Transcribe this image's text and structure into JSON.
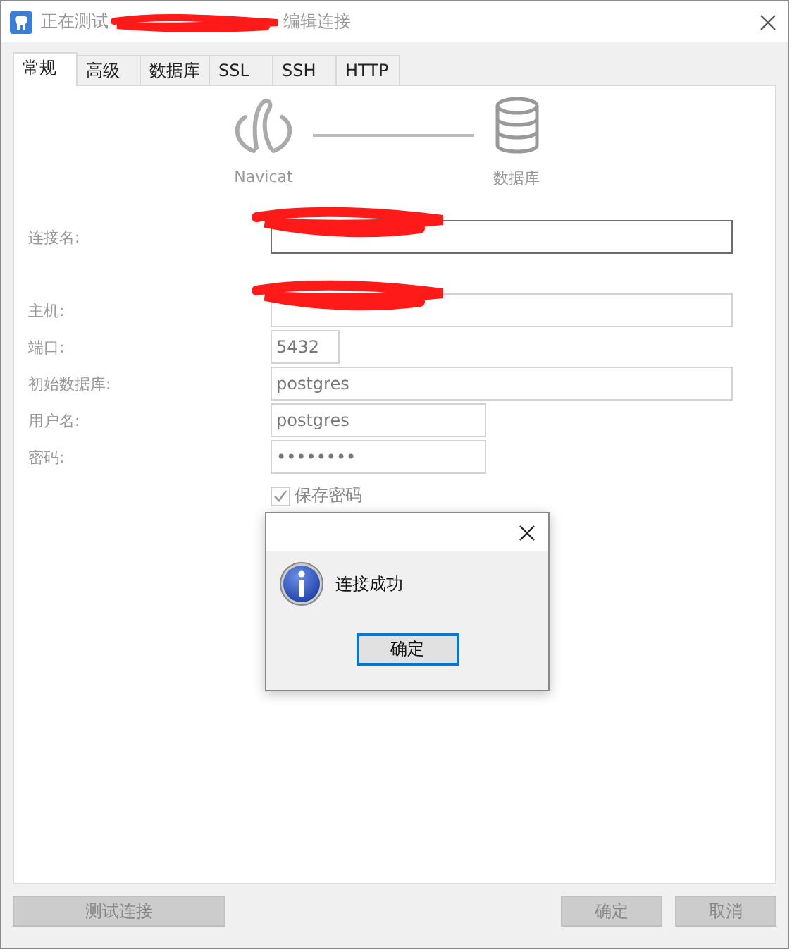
{
  "window": {
    "title_start": "正在测试",
    "title_end": "编辑连接",
    "title_redacted": true,
    "disabled": true
  },
  "tabs": [
    {
      "label": "常规",
      "selected": true
    },
    {
      "label": "高级",
      "selected": false
    },
    {
      "label": "数据库",
      "selected": false
    },
    {
      "label": "SSL",
      "selected": false
    },
    {
      "label": "SSH",
      "selected": false
    },
    {
      "label": "HTTP",
      "selected": false
    }
  ],
  "diagram": {
    "left_label": "Navicat",
    "right_label": "数据库"
  },
  "fields": [
    {
      "label": "连接名:",
      "focused": true,
      "redacted": true
    },
    {
      "label": "主机:",
      "focused": false,
      "redacted": true
    },
    {
      "label": "端口:",
      "value": "5432",
      "focused": false,
      "redacted": false
    },
    {
      "label": "初始数据库:",
      "value": "postgres",
      "focused": false,
      "redacted": false
    },
    {
      "label": "用户名:",
      "value": "postgres",
      "focused": false,
      "redacted": false
    },
    {
      "label": "密码:",
      "value": "••••••••",
      "focused": false,
      "redacted": false
    }
  ],
  "save_password": {
    "label": "保存密码",
    "checked": true
  },
  "buttons": [
    {
      "label": "测试连接"
    },
    {
      "label": "确定"
    },
    {
      "label": "取消"
    }
  ],
  "message_box": {
    "message": "连接成功",
    "button": "确定"
  }
}
